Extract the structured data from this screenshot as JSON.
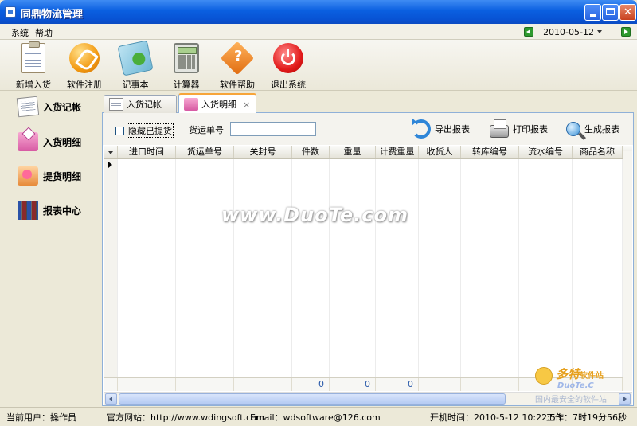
{
  "window": {
    "title": "同鼎物流管理"
  },
  "menu": {
    "items": [
      "系统",
      "帮助"
    ],
    "date": "2010-05-12"
  },
  "toolbar": {
    "buttons": [
      {
        "label": "新增入货",
        "icon": "clipboard-icon"
      },
      {
        "label": "软件注册",
        "icon": "register-icon"
      },
      {
        "label": "记事本",
        "icon": "notebook-icon"
      },
      {
        "label": "计算器",
        "icon": "calculator-icon"
      },
      {
        "label": "软件帮助",
        "icon": "help-icon"
      },
      {
        "label": "退出系统",
        "icon": "power-icon"
      }
    ]
  },
  "sidebar": {
    "items": [
      {
        "label": "入货记帐",
        "icon": "ledger-icon"
      },
      {
        "label": "入货明细",
        "icon": "inbound-detail-icon"
      },
      {
        "label": "提货明细",
        "icon": "pickup-detail-icon"
      },
      {
        "label": "报表中心",
        "icon": "books-icon"
      }
    ]
  },
  "tabs": [
    {
      "label": "入货记帐",
      "active": false
    },
    {
      "label": "入货明细",
      "active": true,
      "close": "×"
    }
  ],
  "filter": {
    "hide_picked_label": "隐藏已提货",
    "hide_picked_checked": false,
    "waybill_label": "货运单号",
    "waybill_value": ""
  },
  "actions": {
    "export": "导出报表",
    "print": "打印报表",
    "generate": "生成报表"
  },
  "grid": {
    "columns": [
      "进口时间",
      "货运单号",
      "关封号",
      "件数",
      "重量",
      "计费重量",
      "收货人",
      "转库编号",
      "流水编号",
      "商品名称"
    ],
    "rows": [],
    "totals": {
      "件数": "0",
      "重量": "0",
      "计费重量": "0"
    }
  },
  "watermark": {
    "text": "www.DuoTe.com",
    "logo_title": "多特",
    "logo_sub": "软件站",
    "logo_url": "DuoTe.C",
    "logo_tagline": "国内最安全的软件站"
  },
  "status": {
    "user": "当前用户：操作员",
    "site": "官方网站：http://www.wdingsoft.com",
    "email": "Email：wdsoftware@126.com",
    "boot_time": "开机时间：2010-5-12 10:22:53",
    "uptime": "工作：7时19分56秒"
  },
  "colors": {
    "titlebar": "#0853d4",
    "tab_accent": "#f7a53a",
    "total_text": "#2456a8"
  }
}
